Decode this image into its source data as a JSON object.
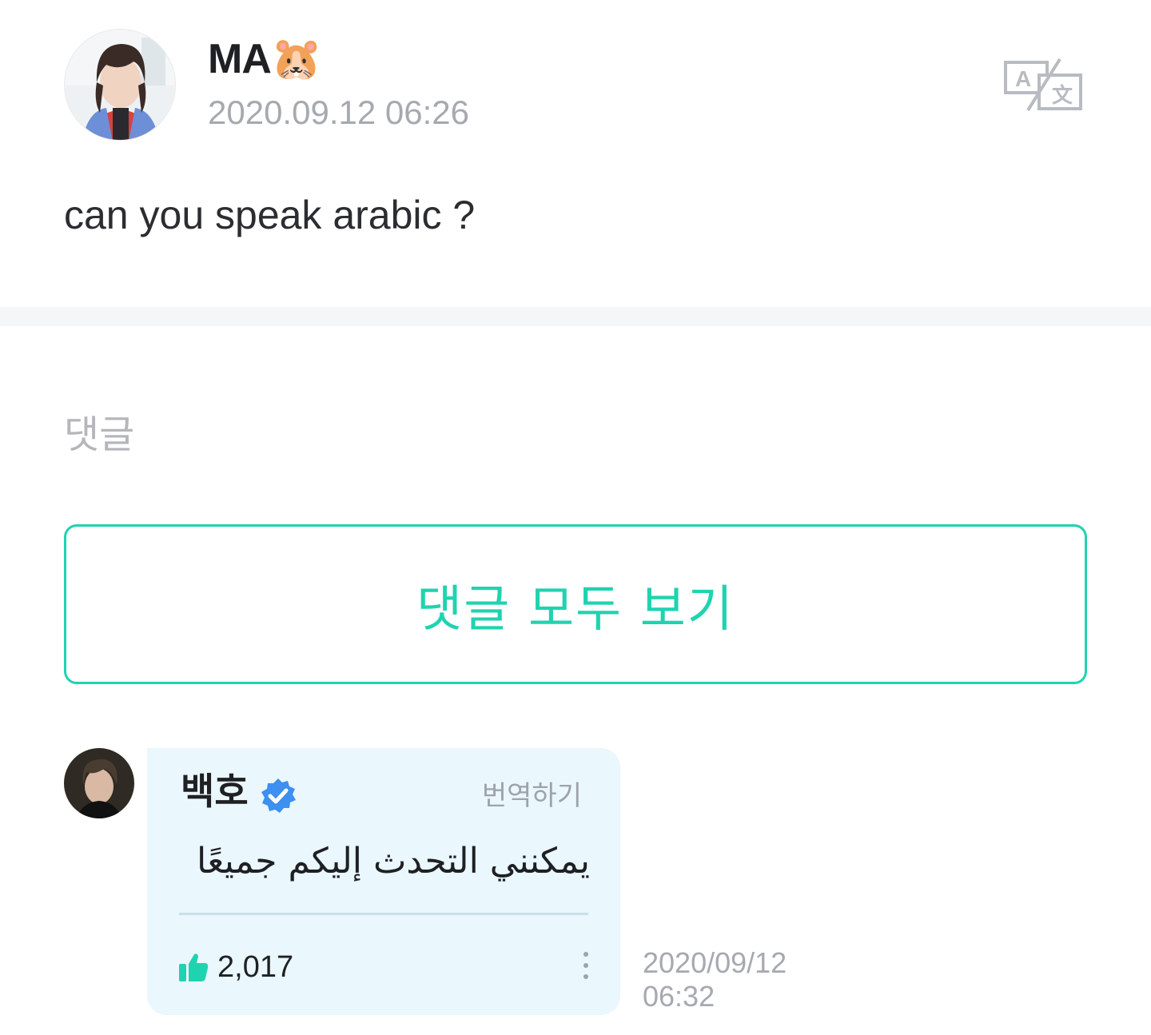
{
  "post": {
    "author": "MA🐹",
    "timestamp": "2020.09.12 06:26",
    "body": "can you speak arabic ?",
    "translate_icon": "translate-icon"
  },
  "comments": {
    "section_title": "댓글",
    "view_all_label": "댓글 모두 보기"
  },
  "reply": {
    "author": "백호",
    "verified_icon": "verified-badge-icon",
    "translate_label": "번역하기",
    "text": "يمكنني التحدث إليكم جميعًا",
    "like_count": "2,017",
    "date": "2020/09/12",
    "time": "06:32"
  },
  "colors": {
    "accent": "#1fd3b0",
    "bubble_bg": "#eaf7fd",
    "muted_text": "#a6a9b0",
    "verified": "#3d8ff0"
  }
}
